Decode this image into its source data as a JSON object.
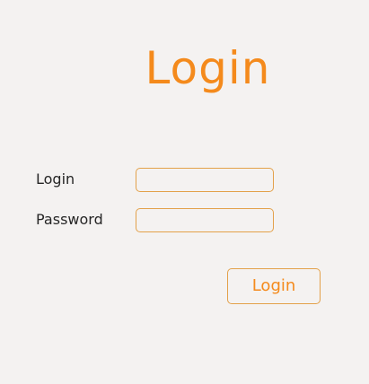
{
  "title": "Login",
  "form": {
    "login_label": "Login",
    "login_value": "",
    "password_label": "Password",
    "password_value": "",
    "submit_label": "Login"
  },
  "colors": {
    "accent": "#f48a1c",
    "field_border": "#e3a14a",
    "background": "#f4f2f1",
    "text": "#262626"
  }
}
